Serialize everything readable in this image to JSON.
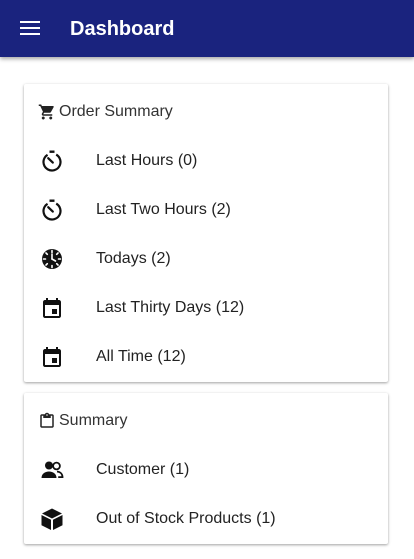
{
  "appbar": {
    "title": "Dashboard",
    "menu_icon": "hamburger-menu-icon",
    "color": "#1a237e"
  },
  "order_summary": {
    "title": "Order Summary",
    "header_icon": "cart-icon",
    "items": [
      {
        "label": "Last Hours (0)",
        "icon": "timer-icon"
      },
      {
        "label": "Last Two Hours (2)",
        "icon": "timer-icon"
      },
      {
        "label": "Todays (2)",
        "icon": "clock-icon"
      },
      {
        "label": "Last Thirty Days (12)",
        "icon": "calendar-icon"
      },
      {
        "label": "All Time (12)",
        "icon": "calendar-icon"
      }
    ]
  },
  "summary": {
    "title": "Summary",
    "header_icon": "clipboard-icon",
    "items": [
      {
        "label": "Customer (1)",
        "icon": "users-icon"
      },
      {
        "label": "Out of Stock Products (1)",
        "icon": "box-icon"
      }
    ]
  }
}
